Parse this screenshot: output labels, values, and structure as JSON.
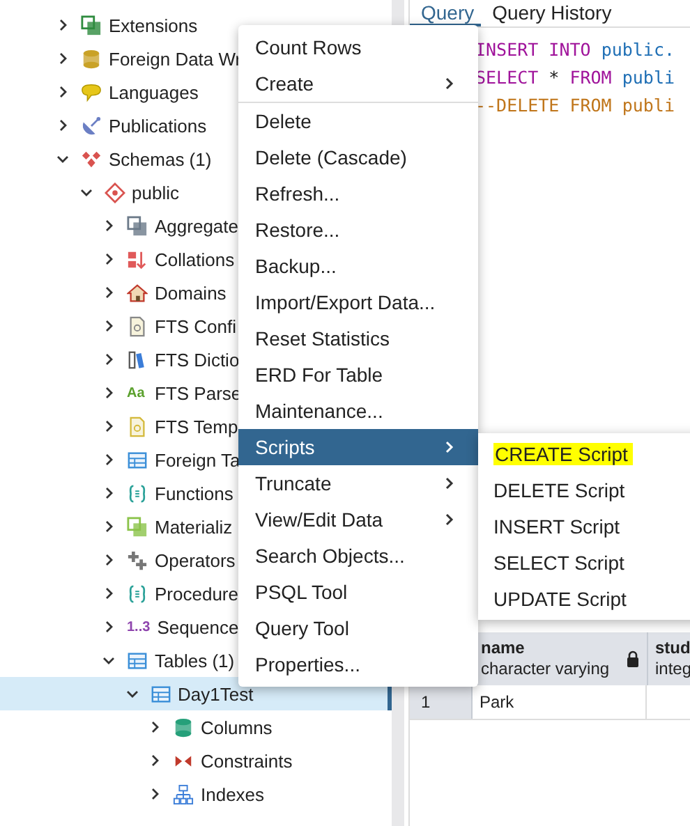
{
  "tree": {
    "items": [
      {
        "label": "Extensions",
        "kind": "extensions",
        "expanded": false
      },
      {
        "label": "Foreign Data Wr",
        "kind": "fdw",
        "expanded": false
      },
      {
        "label": "Languages",
        "kind": "languages",
        "expanded": false
      },
      {
        "label": "Publications",
        "kind": "publications",
        "expanded": false
      },
      {
        "label": "Schemas (1)",
        "kind": "schemas",
        "expanded": true,
        "children": [
          {
            "label": "public",
            "kind": "schema",
            "expanded": true,
            "children": [
              {
                "label": "Aggregate",
                "kind": "aggregates",
                "expanded": false
              },
              {
                "label": "Collations",
                "kind": "collations",
                "expanded": false
              },
              {
                "label": "Domains",
                "kind": "domains",
                "expanded": false
              },
              {
                "label": "FTS Confi",
                "kind": "fts_config",
                "expanded": false
              },
              {
                "label": "FTS Dictio",
                "kind": "fts_dict",
                "expanded": false
              },
              {
                "label": "FTS Parse",
                "kind": "fts_parser",
                "icon_text": "Aa",
                "expanded": false
              },
              {
                "label": "FTS Temp",
                "kind": "fts_template",
                "expanded": false
              },
              {
                "label": "Foreign Ta",
                "kind": "foreign_tables",
                "expanded": false
              },
              {
                "label": "Functions",
                "kind": "functions",
                "expanded": false
              },
              {
                "label": "Materializ",
                "kind": "mviews",
                "expanded": false
              },
              {
                "label": "Operators",
                "kind": "operators",
                "expanded": false
              },
              {
                "label": "Procedure",
                "kind": "procedures",
                "expanded": false
              },
              {
                "label": "Sequence",
                "kind": "sequences",
                "icon_text": "1..3",
                "expanded": false
              },
              {
                "label": "Tables (1)",
                "kind": "tables",
                "expanded": true,
                "children": [
                  {
                    "label": "Day1Test",
                    "kind": "table",
                    "expanded": true,
                    "selected": true,
                    "children": [
                      {
                        "label": "Columns",
                        "kind": "columns",
                        "expanded": false
                      },
                      {
                        "label": "Constraints",
                        "kind": "constraints",
                        "expanded": false
                      },
                      {
                        "label": "Indexes",
                        "kind": "indexes",
                        "expanded": false
                      }
                    ]
                  }
                ]
              }
            ]
          }
        ]
      }
    ]
  },
  "tabs": [
    {
      "label": "Query",
      "selected": true
    },
    {
      "label": "Query History",
      "selected": false
    }
  ],
  "editor": {
    "lines": [
      [
        {
          "kind": "keyword",
          "text": "INSERT INTO"
        },
        {
          "kind": "ident",
          "text": " public."
        }
      ],
      [
        {
          "kind": "keyword",
          "text": "SELECT"
        },
        {
          "kind": "op",
          "text": " * "
        },
        {
          "kind": "keyword",
          "text": "FROM"
        },
        {
          "kind": "ident",
          "text": " publi"
        }
      ],
      [
        {
          "kind": "comment",
          "text": "--DELETE FROM publi"
        }
      ]
    ]
  },
  "grid": {
    "columns": [
      {
        "name": "name",
        "type": "character varying",
        "locked": true
      },
      {
        "name": "stud",
        "type": "integ"
      }
    ],
    "rows": [
      {
        "number": "1",
        "cells": [
          "Park"
        ]
      }
    ]
  },
  "context_menu": {
    "items": [
      {
        "label": "Count Rows",
        "submenu": false,
        "selected": false,
        "divider_after": false
      },
      {
        "label": "Create",
        "submenu": true,
        "selected": false,
        "divider_after": true
      },
      {
        "label": "Delete",
        "submenu": false,
        "selected": false,
        "divider_after": false
      },
      {
        "label": "Delete (Cascade)",
        "submenu": false,
        "selected": false,
        "divider_after": false
      },
      {
        "label": "Refresh...",
        "submenu": false,
        "selected": false,
        "divider_after": false
      },
      {
        "label": "Restore...",
        "submenu": false,
        "selected": false,
        "divider_after": false
      },
      {
        "label": "Backup...",
        "submenu": false,
        "selected": false,
        "divider_after": false
      },
      {
        "label": "Import/Export Data...",
        "submenu": false,
        "selected": false,
        "divider_after": false
      },
      {
        "label": "Reset Statistics",
        "submenu": false,
        "selected": false,
        "divider_after": false
      },
      {
        "label": "ERD For Table",
        "submenu": false,
        "selected": false,
        "divider_after": false
      },
      {
        "label": "Maintenance...",
        "submenu": false,
        "selected": false,
        "divider_after": false
      },
      {
        "label": "Scripts",
        "submenu": true,
        "selected": true,
        "divider_after": false
      },
      {
        "label": "Truncate",
        "submenu": true,
        "selected": false,
        "divider_after": false
      },
      {
        "label": "View/Edit Data",
        "submenu": true,
        "selected": false,
        "divider_after": false
      },
      {
        "label": "Search Objects...",
        "submenu": false,
        "selected": false,
        "divider_after": false
      },
      {
        "label": "PSQL Tool",
        "submenu": false,
        "selected": false,
        "divider_after": false
      },
      {
        "label": "Query Tool",
        "submenu": false,
        "selected": false,
        "divider_after": false
      },
      {
        "label": "Properties...",
        "submenu": false,
        "selected": false,
        "divider_after": false
      }
    ]
  },
  "submenu": {
    "items": [
      {
        "label": "CREATE Script",
        "highlighted": true
      },
      {
        "label": "DELETE Script",
        "highlighted": false
      },
      {
        "label": "INSERT Script",
        "highlighted": false
      },
      {
        "label": "SELECT Script",
        "highlighted": false
      },
      {
        "label": "UPDATE Script",
        "highlighted": false
      }
    ]
  }
}
